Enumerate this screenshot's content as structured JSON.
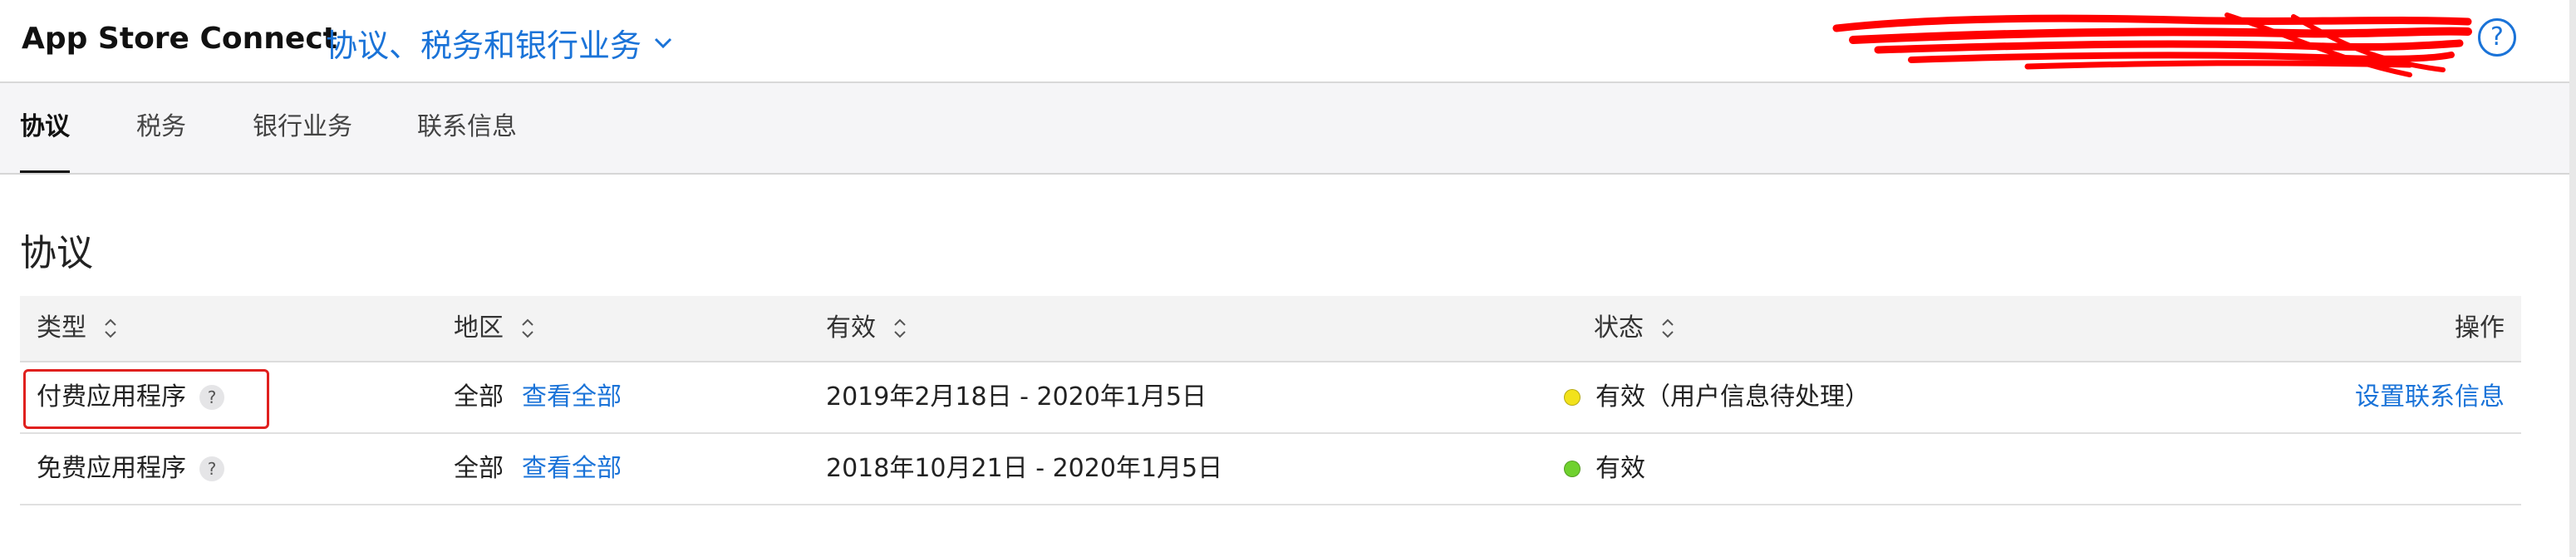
{
  "header": {
    "app_title": "App Store Connect",
    "module_label": "协议、税务和银行业务",
    "help_glyph": "?",
    "redacted_account": true
  },
  "tabs": [
    {
      "label": "协议",
      "active": true
    },
    {
      "label": "税务",
      "active": false
    },
    {
      "label": "银行业务",
      "active": false
    },
    {
      "label": "联系信息",
      "active": false
    }
  ],
  "section": {
    "title": "协议"
  },
  "table": {
    "columns": [
      "类型",
      "地区",
      "有效",
      "状态",
      "操作"
    ],
    "rows": [
      {
        "type": "付费应用程序",
        "type_help": "?",
        "region": "全部",
        "region_link": "查看全部",
        "validity": "2019年2月18日 - 2020年1月5日",
        "status": "有效（用户信息待处理）",
        "status_color": "#f2e21b",
        "action": "设置联系信息",
        "highlighted": true
      },
      {
        "type": "免费应用程序",
        "type_help": "?",
        "region": "全部",
        "region_link": "查看全部",
        "validity": "2018年10月21日 - 2020年1月5日",
        "status": "有效",
        "status_color": "#6fd12e",
        "action": ""
      }
    ]
  },
  "colors": {
    "link": "#1a73d8",
    "highlight": "#e0201e",
    "redaction": "#ff0000"
  },
  "icons": [
    "chevron-down-icon",
    "help-icon",
    "sort-icon",
    "question-icon",
    "status-dot-icon"
  ]
}
